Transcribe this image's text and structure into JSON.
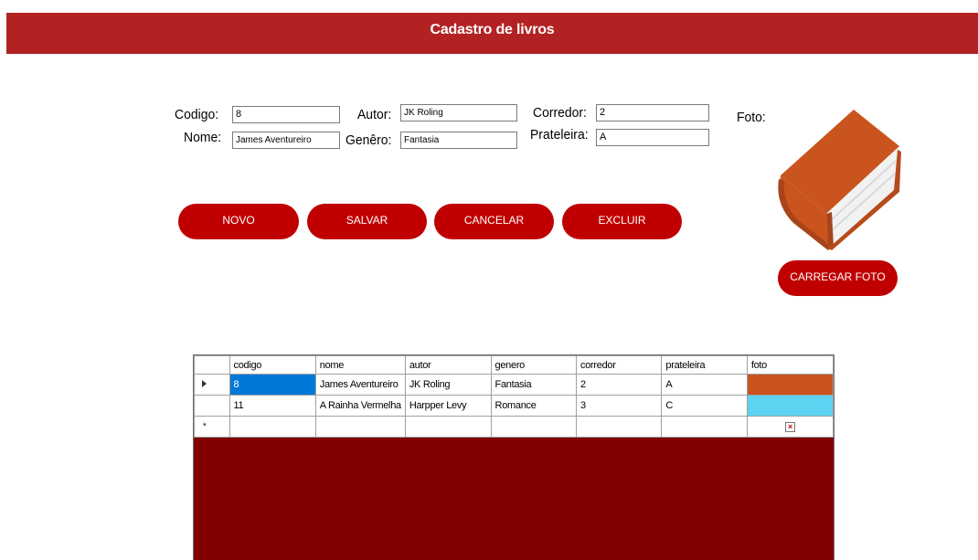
{
  "window": {
    "title": "Cadastro de livros"
  },
  "form": {
    "codigo": {
      "label": "Codigo:",
      "value": "8"
    },
    "nome": {
      "label": "Nome:",
      "value": "James Aventureiro"
    },
    "autor": {
      "label": "Autor:",
      "value": "JK Roling"
    },
    "genero": {
      "label": "Genêro:",
      "value": "Fantasia"
    },
    "corredor": {
      "label": "Corredor:",
      "value": "2"
    },
    "prateleira": {
      "label": "Prateleira:",
      "value": "A"
    },
    "foto_label": "Foto:"
  },
  "buttons": {
    "novo": "NOVO",
    "salvar": "SALVAR",
    "cancelar": "CANCELAR",
    "excluir": "EXCLUIR",
    "carregar_foto": "CARREGAR FOTO"
  },
  "grid": {
    "columns": [
      "codigo",
      "nome",
      "autor",
      "genero",
      "corredor",
      "prateleira",
      "foto"
    ],
    "rows": [
      {
        "codigo": "8",
        "nome": "James Aventureiro",
        "autor": "JK Roling",
        "genero": "Fantasia",
        "corredor": "2",
        "prateleira": "A",
        "foto_color": "#c9541e"
      },
      {
        "codigo": "11",
        "nome": "A Rainha Vermelha",
        "autor": "Harpper Levy",
        "genero": "Romance",
        "corredor": "3",
        "prateleira": "C",
        "foto_color": "#5cd3f0"
      }
    ],
    "new_row_marker": "*"
  },
  "icons": {
    "book": "book-icon",
    "current_row": "row-pointer-icon",
    "broken_image": "broken-image-icon"
  },
  "colors": {
    "titlebar": "#b22222",
    "button": "#c00000",
    "grid_background": "#800000",
    "selection": "#0078d7"
  }
}
